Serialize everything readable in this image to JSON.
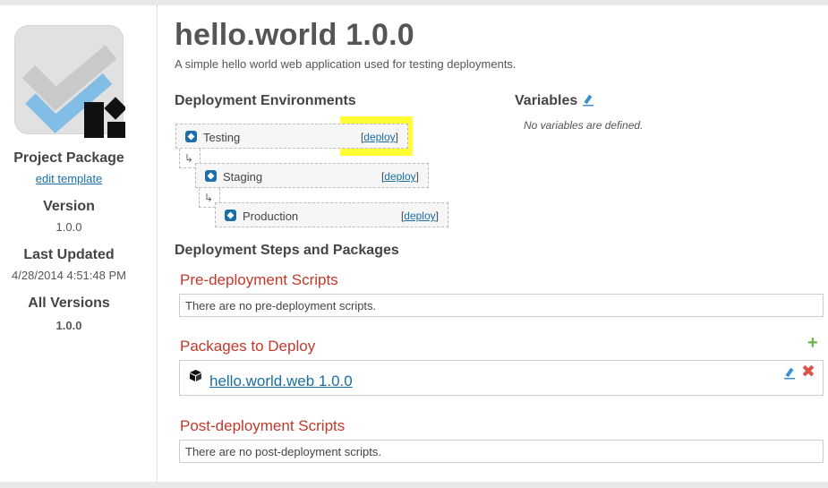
{
  "sidebar": {
    "type_label": "Project Package",
    "edit_template": "edit template",
    "version_label": "Version",
    "version_value": "1.0.0",
    "updated_label": "Last Updated",
    "updated_value": "4/28/2014 4:51:48 PM",
    "all_versions_label": "All Versions",
    "all_versions_value": "1.0.0"
  },
  "header": {
    "title": "hello.world 1.0.0",
    "subtitle": "A simple hello world web application used for testing deployments."
  },
  "environments": {
    "heading": "Deployment Environments",
    "items": [
      {
        "name": "Testing",
        "deploy_label": "deploy"
      },
      {
        "name": "Staging",
        "deploy_label": "deploy"
      },
      {
        "name": "Production",
        "deploy_label": "deploy"
      }
    ],
    "highlight_color": "#ffff33"
  },
  "variables": {
    "heading": "Variables",
    "empty_text": "No variables are defined."
  },
  "steps": {
    "heading": "Deployment Steps and Packages",
    "pre": {
      "heading": "Pre-deployment Scripts",
      "empty_text": "There are no pre-deployment scripts."
    },
    "packages": {
      "heading": "Packages to Deploy",
      "items": [
        {
          "name": "hello.world.web 1.0.0"
        }
      ]
    },
    "post": {
      "heading": "Post-deployment Scripts",
      "empty_text": "There are no post-deployment scripts."
    }
  },
  "icons": {
    "add": "plus-icon",
    "remove": "x-icon",
    "edit": "pencil-icon",
    "package": "cube-icon",
    "environment": "diamond-icon"
  },
  "colors": {
    "link": "#1a6fa6",
    "section_red": "#c0392b",
    "add_green": "#6ab04c",
    "remove_red": "#d9534f"
  }
}
